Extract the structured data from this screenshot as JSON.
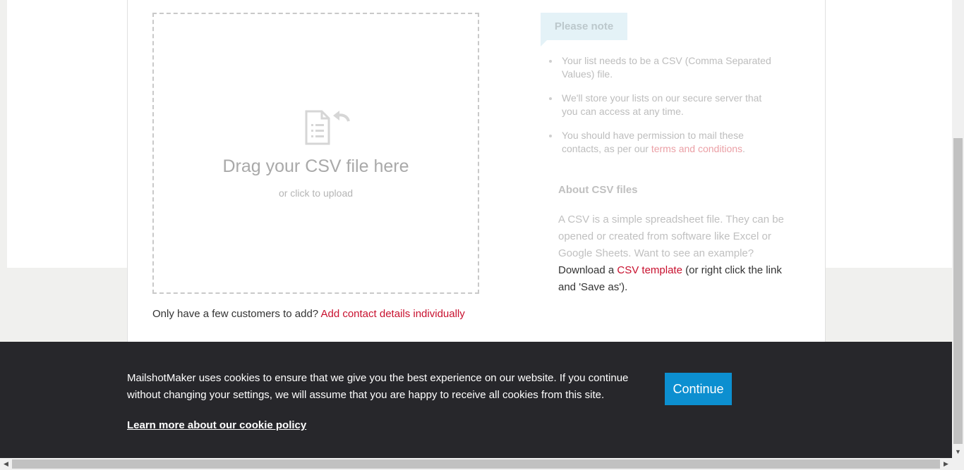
{
  "upload": {
    "title": "Drag your CSV file here",
    "subtitle": "or click to upload",
    "icon": "csv-file-upload-icon"
  },
  "few_customers": {
    "prefix": "Only have a few customers to add?",
    "link_label": "Add contact details individually"
  },
  "note": {
    "tab_label": "Please note",
    "items": [
      {
        "text": "Your list needs to be a CSV (Comma Separated Values) file."
      },
      {
        "text": "We'll store your lists on our secure server that you can access at any time."
      },
      {
        "text_before": "You should have permission to mail these contacts, as per our",
        "link": "terms and conditions",
        "text_after": "."
      }
    ]
  },
  "about": {
    "title": "About CSV files",
    "text": "A CSV is a simple spreadsheet file. They can be opened or created from software like Excel or Google Sheets. Want to see an example?",
    "download_prefix": "Download a",
    "template_link": "CSV template",
    "download_suffix": "(or right click the link and 'Save as')."
  },
  "cookie": {
    "message": "MailshotMaker uses cookies to ensure that we give you the best experience on our website. If you continue without changing your settings, we will assume that you are happy to receive all cookies from this site.",
    "policy_link": "Learn more about our cookie policy",
    "continue_label": "Continue"
  },
  "scrollbars": {
    "down_arrow": "▼",
    "left_arrow": "◀",
    "right_arrow": "▶"
  },
  "colors": {
    "accent_link": "#c8102e",
    "cookie_bg": "#27272b",
    "button_blue": "#0c8fd0",
    "note_tab_bg": "#e4f2f7"
  }
}
